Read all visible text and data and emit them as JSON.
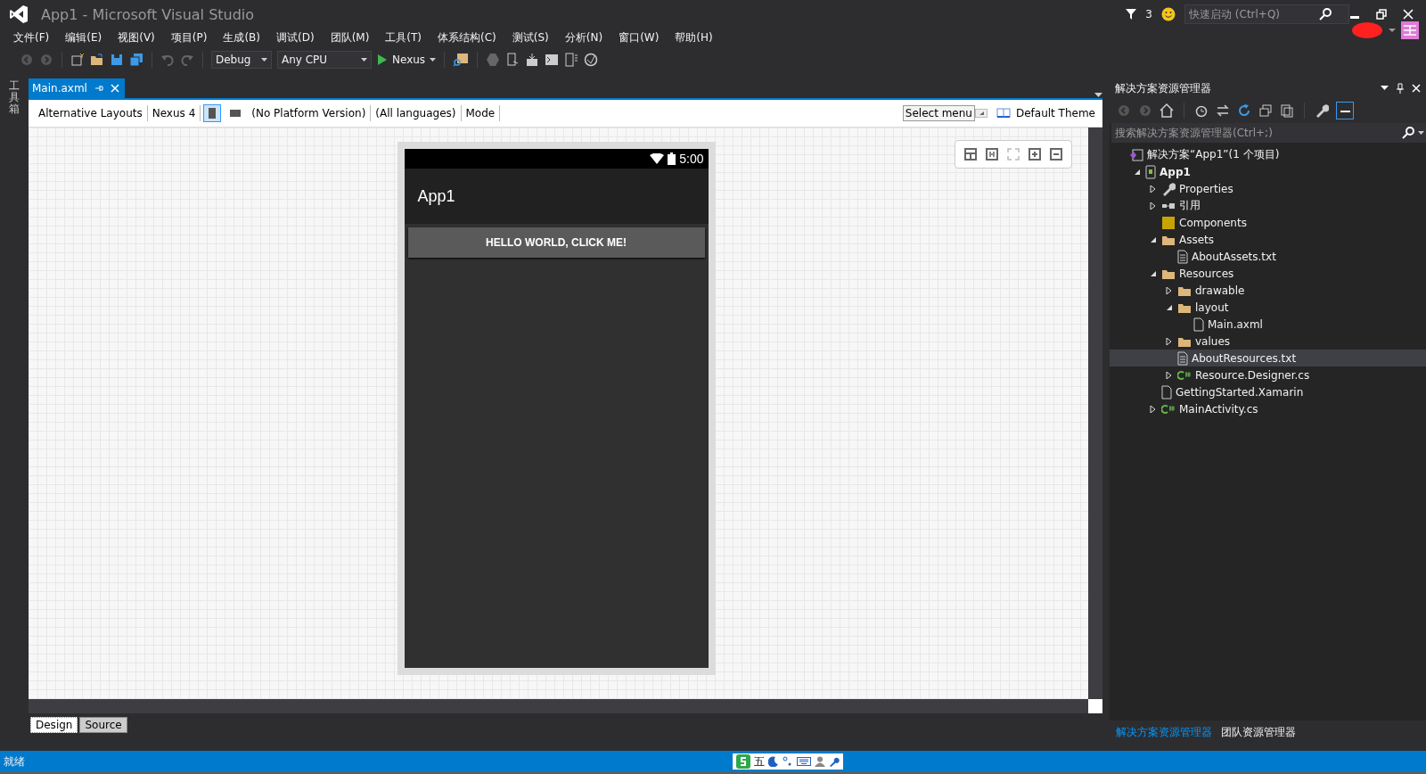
{
  "window": {
    "title": "App1 - Microsoft Visual Studio",
    "notification_count": "3",
    "quick_launch": {
      "placeholder": "快速启动 (Ctrl+Q)"
    }
  },
  "menu": [
    "文件(F)",
    "编辑(E)",
    "视图(V)",
    "项目(P)",
    "生成(B)",
    "调试(D)",
    "团队(M)",
    "工具(T)",
    "体系结构(C)",
    "测试(S)",
    "分析(N)",
    "窗口(W)",
    "帮助(H)"
  ],
  "toolbar": {
    "configuration": "Debug",
    "platform": "Any CPU",
    "run_target": "Nexus"
  },
  "toolbox_tab": "工具箱",
  "document_tab": {
    "title": "Main.axml"
  },
  "designer_bar": {
    "layouts": "Alternative Layouts",
    "device": "Nexus 4",
    "orientations": [
      {
        "kind": "portrait",
        "selected": true
      },
      {
        "kind": "landscape",
        "selected": false
      }
    ],
    "platform_version": "(No Platform Version)",
    "languages": "(All languages)",
    "mode": "Mode",
    "menu_button": "Select menu",
    "theme": "Default Theme"
  },
  "phone": {
    "time": "5:00",
    "app_title": "App1",
    "button": "HELLO WORLD, CLICK ME!"
  },
  "view_tabs": [
    {
      "label": "Design",
      "selected": true
    },
    {
      "label": "Source",
      "selected": false
    }
  ],
  "solution_explorer": {
    "title": "解决方案资源管理器",
    "search": {
      "placeholder": "搜索解决方案资源管理器(Ctrl+;)"
    },
    "tree": [
      {
        "label": "解决方案“App1”(1 个项目)",
        "kind": "solution",
        "selected": false,
        "children": [
          {
            "label": "App1",
            "kind": "project",
            "expanded": true,
            "selected": false,
            "children": [
              {
                "label": "Properties",
                "kind": "wrench",
                "expanded": false,
                "selected": false
              },
              {
                "label": "引用",
                "kind": "references",
                "expanded": false,
                "selected": false
              },
              {
                "label": "Components",
                "kind": "components",
                "selected": false
              },
              {
                "label": "Assets",
                "kind": "folder",
                "expanded": true,
                "selected": false,
                "children": [
                  {
                    "label": "AboutAssets.txt",
                    "kind": "text",
                    "selected": false
                  }
                ]
              },
              {
                "label": "Resources",
                "kind": "folder",
                "expanded": true,
                "selected": false,
                "children": [
                  {
                    "label": "drawable",
                    "kind": "folder",
                    "expanded": false,
                    "selected": false
                  },
                  {
                    "label": "layout",
                    "kind": "folder",
                    "expanded": true,
                    "selected": false,
                    "children": [
                      {
                        "label": "Main.axml",
                        "kind": "file",
                        "selected": false
                      }
                    ]
                  },
                  {
                    "label": "values",
                    "kind": "folder",
                    "expanded": false,
                    "selected": false
                  },
                  {
                    "label": "AboutResources.txt",
                    "kind": "text",
                    "selected": true
                  },
                  {
                    "label": "Resource.Designer.cs",
                    "kind": "csharp",
                    "expanded": false,
                    "selected": false
                  }
                ]
              },
              {
                "label": "GettingStarted.Xamarin",
                "kind": "file",
                "selected": false
              },
              {
                "label": "MainActivity.cs",
                "kind": "csharp",
                "expanded": false,
                "selected": false
              }
            ]
          }
        ]
      }
    ],
    "bottom_tabs": [
      {
        "label": "解决方案资源管理器",
        "selected": true
      },
      {
        "label": "团队资源管理器",
        "selected": false
      }
    ]
  },
  "status_bar": {
    "text": "就绪",
    "ime_mode": "五"
  }
}
